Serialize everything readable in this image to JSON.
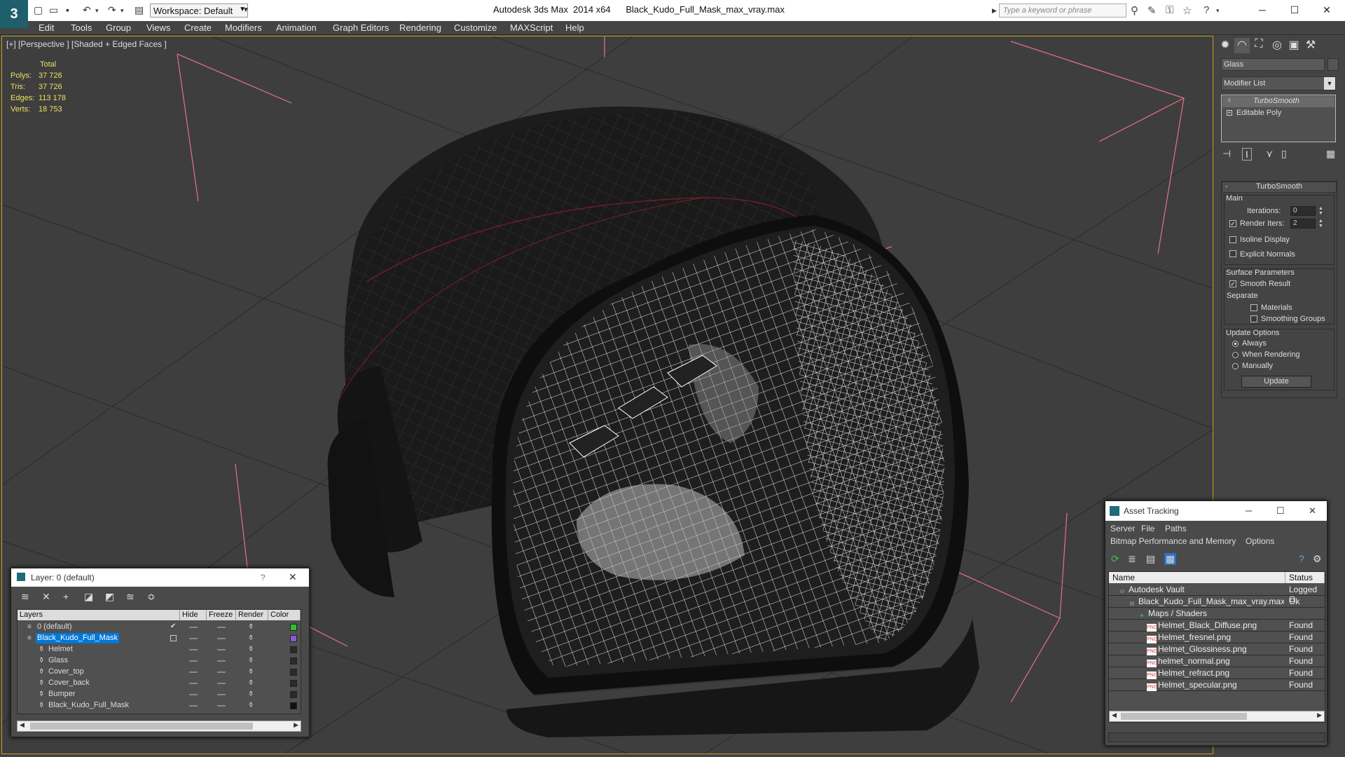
{
  "titlebar": {
    "workspace": "Workspace: Default",
    "app_title": "Autodesk 3ds Max  2014 x64      Black_Kudo_Full_Mask_max_vray.max",
    "search_placeholder": "Type a keyword or phrase"
  },
  "menu": [
    "Edit",
    "Tools",
    "Group",
    "Views",
    "Create",
    "Modifiers",
    "Animation",
    "Graph Editors",
    "Rendering",
    "Customize",
    "MAXScript",
    "Help"
  ],
  "viewport": {
    "label": "[+] [Perspective ] [Shaded + Edged Faces ]",
    "stats": {
      "header": "Total",
      "polys_label": "Polys:",
      "polys": "37 726",
      "tris_label": "Tris:",
      "tris": "37 726",
      "edges_label": "Edges:",
      "edges": "113 178",
      "verts_label": "Verts:",
      "verts": "18 753"
    }
  },
  "command_panel": {
    "object_name": "Glass",
    "modifier_list": "Modifier List",
    "stack": [
      "TurboSmooth",
      "Editable Poly"
    ],
    "rollout_title": "TurboSmooth",
    "main_label": "Main",
    "iterations_label": "Iterations:",
    "iterations": "0",
    "render_iters_label": "Render Iters:",
    "render_iters": "2",
    "render_iters_checked": true,
    "isoline_label": "Isoline Display",
    "explicit_label": "Explicit Normals",
    "surface_label": "Surface Parameters",
    "smooth_result_label": "Smooth Result",
    "separate_label": "Separate",
    "materials_label": "Materials",
    "smoothing_groups_label": "Smoothing Groups",
    "update_options_label": "Update Options",
    "always_label": "Always",
    "when_rendering_label": "When Rendering",
    "manually_label": "Manually",
    "update_button": "Update"
  },
  "layer_dialog": {
    "title": "Layer: 0 (default)",
    "help": "?",
    "columns": [
      "Layers",
      "Hide",
      "Freeze",
      "Render",
      "Color"
    ],
    "rows": [
      {
        "name": "0 (default)",
        "color": "#2fbf2f",
        "level": 0
      },
      {
        "name": "Black_Kudo_Full_Mask",
        "color": "#8a5ad0",
        "level": 0,
        "selected": true
      },
      {
        "name": "Helmet",
        "color": "#2a2a2a",
        "level": 1
      },
      {
        "name": "Glass",
        "color": "#2a2a2a",
        "level": 1
      },
      {
        "name": "Cover_top",
        "color": "#2a2a2a",
        "level": 1
      },
      {
        "name": "Cover_back",
        "color": "#2a2a2a",
        "level": 1
      },
      {
        "name": "Bumper",
        "color": "#2a2a2a",
        "level": 1
      },
      {
        "name": "Black_Kudo_Full_Mask",
        "color": "#111111",
        "level": 1
      }
    ]
  },
  "asset_tracking": {
    "title": "Asset Tracking",
    "menu1": [
      "Server",
      "File",
      "Paths"
    ],
    "menu2": [
      "Bitmap Performance and Memory",
      "Options"
    ],
    "columns": [
      "Name",
      "Status"
    ],
    "rows": [
      {
        "name": "Autodesk Vault",
        "status": "Logged O",
        "level": 0,
        "icon": "vault-icon"
      },
      {
        "name": "Black_Kudo_Full_Mask_max_vray.max",
        "status": "Ok",
        "level": 1,
        "icon": "max-file-icon"
      },
      {
        "name": "Maps / Shaders",
        "status": "",
        "level": 2,
        "icon": "maps-icon"
      },
      {
        "name": "Helmet_Black_Diffuse.png",
        "status": "Found",
        "level": 3,
        "icon": "png-icon"
      },
      {
        "name": "Helmet_fresnel.png",
        "status": "Found",
        "level": 3,
        "icon": "png-icon"
      },
      {
        "name": "Helmet_Glossiness.png",
        "status": "Found",
        "level": 3,
        "icon": "png-icon"
      },
      {
        "name": "helmet_normal.png",
        "status": "Found",
        "level": 3,
        "icon": "png-icon"
      },
      {
        "name": "Helmet_refract.png",
        "status": "Found",
        "level": 3,
        "icon": "png-icon"
      },
      {
        "name": "Helmet_specular.png",
        "status": "Found",
        "level": 3,
        "icon": "png-icon"
      }
    ]
  },
  "colors": {
    "viewport_bg": "#3e3e3e",
    "panel_bg": "#444444",
    "selection": "#0078d7",
    "stats": "#f0e060",
    "gizmo": "#e8708a",
    "wireframe": "#ffffff"
  }
}
